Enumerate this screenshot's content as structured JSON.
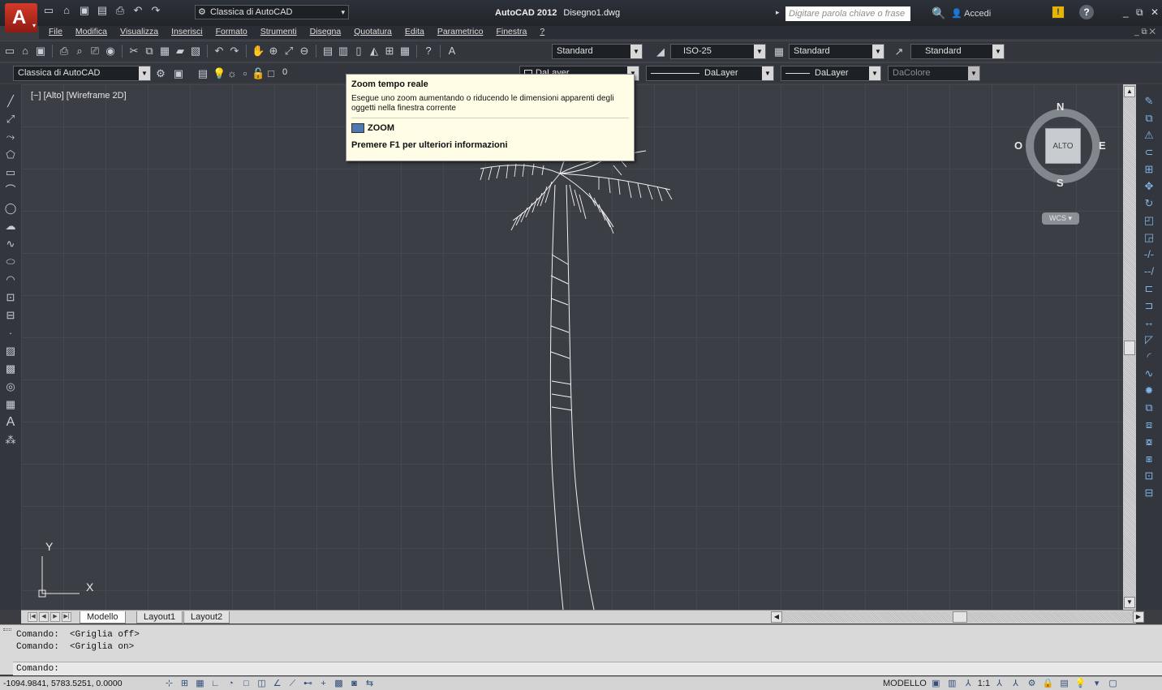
{
  "window": {
    "app_name": "AutoCAD 2012",
    "doc_name": "Disegno1.dwg",
    "workspace": "Classica di AutoCAD",
    "search_placeholder": "Digitare parola chiave o frase",
    "signin": "Accedi"
  },
  "menu": {
    "items": [
      "File",
      "Modifica",
      "Visualizza",
      "Inserisci",
      "Formato",
      "Strumenti",
      "Disegna",
      "Quotatura",
      "Edita",
      "Parametrico",
      "Finestra",
      "?"
    ]
  },
  "styles_toolbar": {
    "text_style": "Standard",
    "dim_style": "ISO-25",
    "table_style": "Standard",
    "multileader_style": "Standard"
  },
  "layers_toolbar": {
    "workspace": "Classica di AutoCAD",
    "layer": "0",
    "color": "DaLayer",
    "linetype": "DaLayer",
    "lineweight": "DaLayer",
    "plotstyle": "DaColore"
  },
  "viewport": {
    "label": "[−] [Alto] [Wireframe 2D]"
  },
  "viewcube": {
    "face": "ALTO",
    "north": "N",
    "south": "S",
    "east": "E",
    "west": "O",
    "wcs": "WCS"
  },
  "ucs": {
    "x": "X",
    "y": "Y"
  },
  "tooltip": {
    "title": "Zoom tempo reale",
    "description": "Esegue uno zoom aumentando o riducendo le dimensioni apparenti degli oggetti nella finestra corrente",
    "command": "ZOOM",
    "help": "Premere F1 per ulteriori informazioni"
  },
  "tabs": [
    "Modello",
    "Layout1",
    "Layout2"
  ],
  "command": {
    "history": [
      "Comando:  <Griglia off>",
      "Comando:  <Griglia on>"
    ],
    "prompt": "Comando:"
  },
  "status": {
    "coords": "-1094.9841, 5783.5251, 0.0000",
    "space": "MODELLO",
    "scale": "1:1"
  },
  "icons": {
    "qat": [
      "new-icon",
      "open-icon",
      "save-icon",
      "saveas-icon",
      "plot-icon",
      "undo-icon",
      "redo-icon"
    ],
    "left_tools": [
      "line-icon",
      "construction-line-icon",
      "polyline-icon",
      "polygon-icon",
      "rectangle-icon",
      "arc-icon",
      "circle-icon",
      "revcloud-icon",
      "spline-icon",
      "ellipse-icon",
      "ellipse-arc-icon",
      "insert-block-icon",
      "make-block-icon",
      "point-icon",
      "hatch-icon",
      "gradient-icon",
      "region-icon",
      "table-icon",
      "mtext-icon",
      "add-selected-icon"
    ],
    "right_tools": [
      "erase-icon",
      "copy-icon",
      "mirror-icon",
      "offset-icon",
      "array-icon",
      "move-icon",
      "rotate-icon",
      "scale-icon",
      "stretch-icon",
      "trim-icon",
      "extend-icon",
      "break-point-icon",
      "break-icon",
      "join-icon",
      "chamfer-icon",
      "fillet-icon",
      "blend-icon",
      "explode-icon",
      "draworder-front-icon",
      "draworder-back-icon",
      "draworder-above-icon",
      "draworder-under-icon",
      "text-front-icon",
      "hatch-back-icon"
    ]
  }
}
